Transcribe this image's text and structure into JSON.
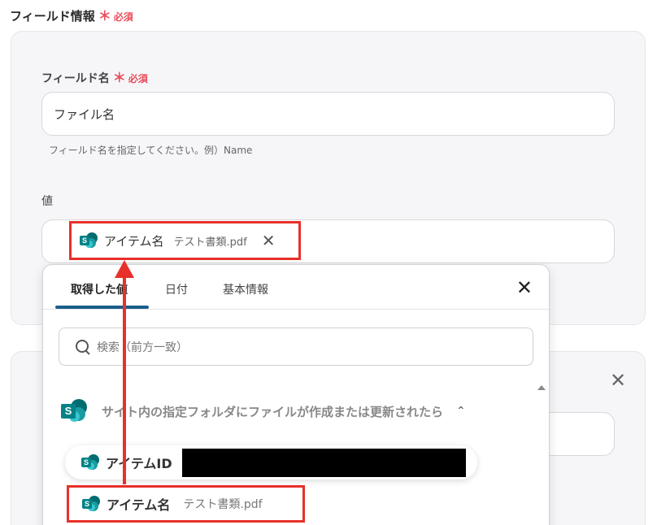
{
  "section": {
    "title": "フィールド情報",
    "required_star": "＊",
    "required_text": "必須"
  },
  "field_name": {
    "label": "フィールド名",
    "required_star": "＊",
    "required_text": "必須",
    "value": "ファイル名",
    "helper": "フィールド名を指定してください。例）Name"
  },
  "value_field": {
    "label": "値",
    "chip": {
      "icon": "sharepoint-icon",
      "label": "アイテム名",
      "sub": "テスト書類.pdf",
      "close": "✕"
    }
  },
  "dropdown": {
    "tabs": [
      "取得した値",
      "日付",
      "基本情報"
    ],
    "close": "✕",
    "search_placeholder": "検索（前方一致）",
    "group": {
      "title": "サイト内の指定フォルダにファイルが作成または更新されたら",
      "chevron": "⌃"
    },
    "items": [
      {
        "label": "アイテムID",
        "sub": ""
      },
      {
        "label": "アイテム名",
        "sub": "テスト書類.pdf"
      }
    ]
  },
  "card2": {
    "close": "✕"
  },
  "colors": {
    "required": "#ea4c5a",
    "highlight": "#e8302a",
    "tab_active": "#1a5f8a",
    "sharepoint": "#038387"
  }
}
